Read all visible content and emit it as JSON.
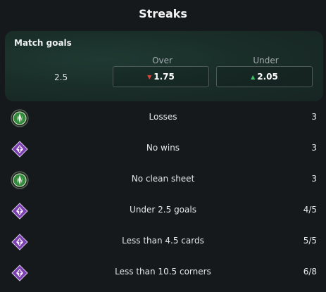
{
  "header": {
    "title": "Streaks"
  },
  "match_goals": {
    "title": "Match goals",
    "line": "2.5",
    "over": {
      "label": "Over",
      "odd": "1.75",
      "trend": "down"
    },
    "under": {
      "label": "Under",
      "odd": "2.05",
      "trend": "up"
    }
  },
  "streaks": [
    {
      "team_icon": "green-club-crest-icon",
      "label": "Losses",
      "value": "3"
    },
    {
      "team_icon": "fiorentina-crest-icon",
      "label": "No wins",
      "value": "3"
    },
    {
      "team_icon": "green-club-crest-icon",
      "label": "No clean sheet",
      "value": "3"
    },
    {
      "team_icon": "fiorentina-crest-icon",
      "label": "Under 2.5 goals",
      "value": "4/5"
    },
    {
      "team_icon": "fiorentina-crest-icon",
      "label": "Less than 4.5 cards",
      "value": "5/5"
    },
    {
      "team_icon": "fiorentina-crest-icon",
      "label": "Less than 10.5 corners",
      "value": "6/8"
    }
  ],
  "colors": {
    "background": "#16191b",
    "card": "#1a2e29",
    "down_arrow": "#e0473c",
    "up_arrow": "#3fbf6a",
    "fiorentina_purple": "#7b3fb0",
    "green_club": "#2f8a3a"
  }
}
